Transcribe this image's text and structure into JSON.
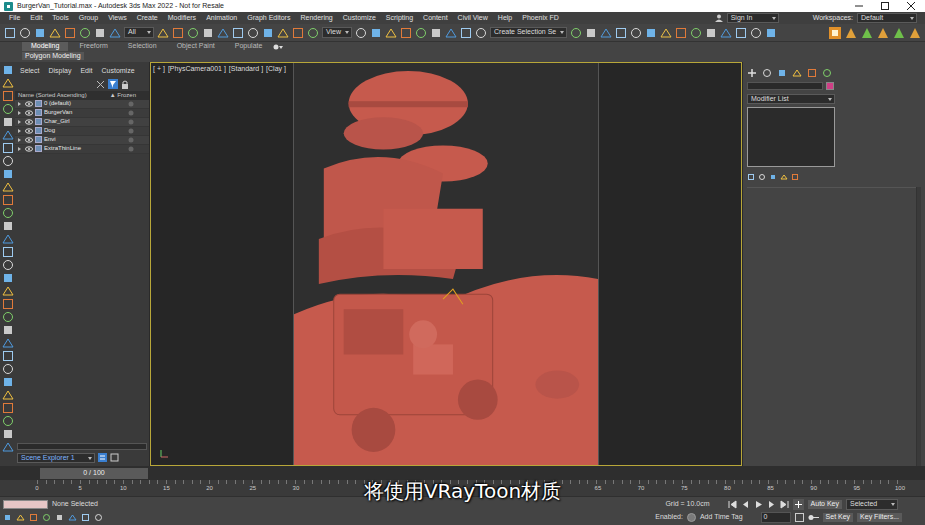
{
  "window": {
    "title": "BurgerVan_Tutorial.max - Autodesk 3ds Max 2022 - Not for Resale"
  },
  "menu": [
    "File",
    "Edit",
    "Tools",
    "Group",
    "Views",
    "Create",
    "Modifiers",
    "Animation",
    "Graph Editors",
    "Rendering",
    "Customize",
    "Scripting",
    "Content",
    "Civil View",
    "Help",
    "Phoenix FD"
  ],
  "account": {
    "label": "Sign In"
  },
  "workspaces": {
    "label": "Workspaces:",
    "value": "Default"
  },
  "toolbar": {
    "selection_filter": "All",
    "reference_coordinates": "View",
    "selection_set": "Create Selection Se"
  },
  "ribbon": {
    "tabs": [
      {
        "label": "Modeling",
        "selected": true
      },
      {
        "label": "Freeform",
        "selected": false
      },
      {
        "label": "Selection",
        "selected": false
      },
      {
        "label": "Object Paint",
        "selected": false
      },
      {
        "label": "Populate",
        "selected": false
      }
    ],
    "panel": "Polygon Modeling"
  },
  "scene_explorer": {
    "menu": [
      "Select",
      "Display",
      "Edit",
      "Customize"
    ],
    "columns": [
      "Name (Sorted Ascending)",
      "▲ Frozen"
    ],
    "rows": [
      {
        "name": "0 (default)"
      },
      {
        "name": "BurgerVan"
      },
      {
        "name": "Char_Girl"
      },
      {
        "name": "Dog"
      },
      {
        "name": "Envi"
      },
      {
        "name": "ExtraThinLine"
      }
    ],
    "footer": "Scene Explorer 1"
  },
  "viewport": {
    "labels": [
      "[ + ]",
      "[PhysCamera001 ]",
      "[Standard ]",
      "[Clay ]"
    ]
  },
  "command_panel": {
    "modifier_list": "Modifier List"
  },
  "timeline": {
    "position": "0 / 100",
    "ticks": [
      "0",
      "5",
      "10",
      "15",
      "20",
      "25",
      "30",
      "65",
      "70",
      "75",
      "80",
      "85",
      "90",
      "95",
      "100"
    ]
  },
  "status_bar": {
    "selection": "None Selected",
    "enabled": "Enabled:",
    "time_tag": "Add Time Tag",
    "grid": "Grid = 10.0cm",
    "frame": "0",
    "auto_key": "Auto Key",
    "key_mode": "Selected",
    "set_key": "Set Key",
    "key_filters": "Key Filters..."
  },
  "subtitle": "将使用VRayToon材质"
}
